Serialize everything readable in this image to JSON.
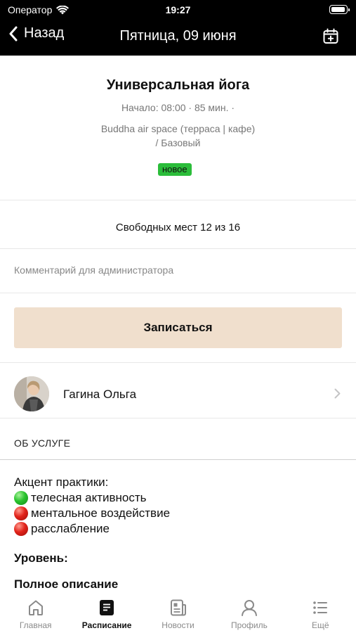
{
  "status": {
    "carrier": "Оператор",
    "time": "19:27"
  },
  "nav": {
    "back_label": "Назад",
    "title": "Пятница, 09 июня"
  },
  "class": {
    "title": "Универсальная йога",
    "meta": "Начало: 08:00  ·  85 мин.  ·",
    "location_line1": "Buddha air space (терраса | кафе)",
    "location_line2": "/ Базовый",
    "badge": "новое"
  },
  "slots_text": "Свободных мест 12 из 16",
  "comment_placeholder": "Комментарий для администратора",
  "signup_label": "Записаться",
  "trainer": {
    "name": "Гагина Ольга"
  },
  "about_header": "ОБ УСЛУГЕ",
  "description": {
    "accent_title": "Акцент практики:",
    "items": [
      {
        "color": "#29c32e",
        "text": "телесная активность"
      },
      {
        "color": "#e2231a",
        "text": "ментальное воздействие"
      },
      {
        "color": "#e2231a",
        "text": "расслабление"
      }
    ],
    "level_label": "Уровень:",
    "full_desc_label": "Полное описание"
  },
  "tabs": [
    {
      "label": "Главная",
      "icon": "home-icon",
      "active": false
    },
    {
      "label": "Расписание",
      "icon": "schedule-icon",
      "active": true
    },
    {
      "label": "Новости",
      "icon": "news-icon",
      "active": false
    },
    {
      "label": "Профиль",
      "icon": "profile-icon",
      "active": false
    },
    {
      "label": "Ещё",
      "icon": "more-icon",
      "active": false
    }
  ],
  "colors": {
    "header_bg": "#000000",
    "badge_bg": "#2bbd3a",
    "button_bg": "#f0dfcd"
  }
}
